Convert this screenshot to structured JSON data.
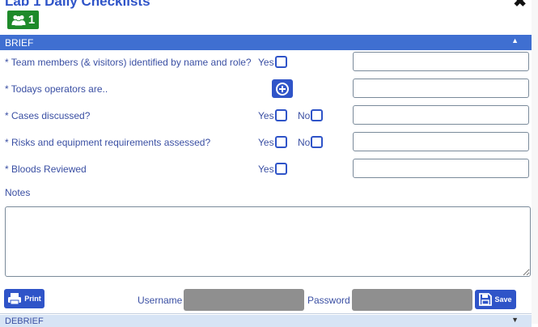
{
  "window": {
    "title": "Lab 1 Daily Checklists"
  },
  "badge": {
    "count": "1"
  },
  "brief": {
    "header": "BRIEF",
    "questions": [
      {
        "label": "* Team members (& visitors) identified by name and role?",
        "yes": "Yes"
      },
      {
        "label": "* Todays operators are.."
      },
      {
        "label": "* Cases discussed?",
        "yes": "Yes",
        "no": "No"
      },
      {
        "label": "* Risks and equipment requirements assessed?",
        "yes": "Yes",
        "no": "No"
      },
      {
        "label": "* Bloods Reviewed",
        "yes": "Yes"
      }
    ],
    "notes_label": "Notes"
  },
  "footer": {
    "print_label": "Print",
    "username_label": "Username",
    "password_label": "Password",
    "save_label": "Save"
  },
  "debrief": {
    "header": "DEBRIEF"
  },
  "icons": {
    "users": "users-icon",
    "plus": "plus-circle-icon",
    "print": "printer-icon",
    "save": "floppy-disk-icon",
    "close": "close-icon"
  },
  "colors": {
    "accent": "#2f54c8",
    "header_bar": "#3f6fd1",
    "badge_green": "#1e8a2a",
    "credential_input": "#8f8f8f"
  }
}
